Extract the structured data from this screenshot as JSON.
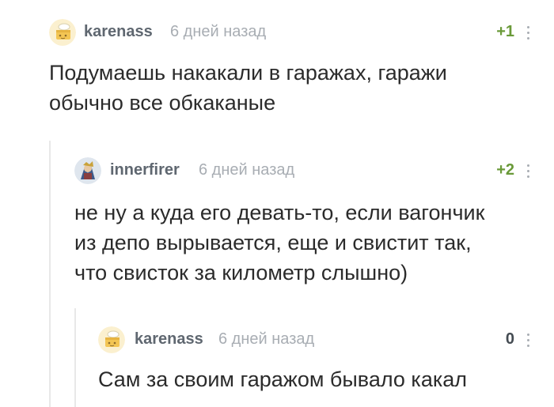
{
  "comments": [
    {
      "username": "karenass",
      "time": "6 дней назад",
      "rating": "+1",
      "lines": [
        "Подумаешь накакали в гаражах, гаражи",
        "обычно все обкаканые"
      ],
      "avatar_icon": "cake-avatar-icon"
    },
    {
      "username": "innerfirer",
      "time": "6 дней назад",
      "rating": "+2",
      "lines": [
        "не ну а куда его девать-то, если вагончик",
        "из депо вырывается, еще и свистит так,",
        "что свисток за километр слышно)"
      ],
      "avatar_icon": "character-avatar-icon"
    },
    {
      "username": "karenass",
      "time": "6 дней назад",
      "rating": "0",
      "lines": [
        "Сам за своим гаражом бывало какал"
      ],
      "avatar_icon": "cake-avatar-icon"
    }
  ],
  "colors": {
    "positive_rating": "#6a9a39",
    "neutral_rating": "#444b52",
    "username": "#5f6770",
    "timestamp": "#a8adb3",
    "thread_line": "#e8e8e8"
  }
}
